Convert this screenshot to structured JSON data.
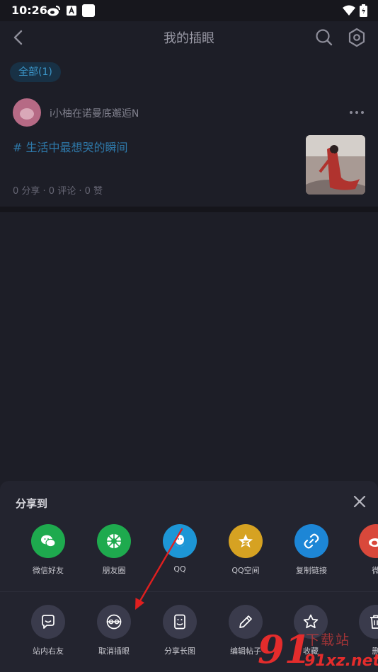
{
  "status_bar": {
    "time": "10:26"
  },
  "header": {
    "title": "我的插眼"
  },
  "filter": {
    "label": "全部(1)"
  },
  "post": {
    "author": "i小柚在诺曼底邂逅N",
    "tag": "# 生活中最想哭的瞬间",
    "stats": "0 分享 · 0 评论 · 0 赞"
  },
  "share_sheet": {
    "title": "分享到",
    "share_targets": [
      {
        "label": "微信好友",
        "color": "#1eaa4e",
        "icon": "wechat-icon"
      },
      {
        "label": "朋友圈",
        "color": "#1eaa4e",
        "icon": "moments-icon"
      },
      {
        "label": "QQ",
        "color": "#1d96d6",
        "icon": "qq-icon"
      },
      {
        "label": "QQ空间",
        "color": "#d6a222",
        "icon": "qzone-icon"
      },
      {
        "label": "复制链接",
        "color": "#1d86d6",
        "icon": "link-icon"
      },
      {
        "label": "微",
        "color": "#d9483b",
        "icon": "weibo-icon"
      }
    ],
    "actions": [
      {
        "label": "站内右友",
        "icon": "chat-face-icon"
      },
      {
        "label": "取消插眼",
        "icon": "eye-off-icon"
      },
      {
        "label": "分享长图",
        "icon": "long-image-icon"
      },
      {
        "label": "编辑帖子",
        "icon": "pencil-icon"
      },
      {
        "label": "收藏",
        "icon": "star-icon"
      },
      {
        "label": "删",
        "icon": "trash-icon"
      }
    ]
  },
  "watermark": {
    "number": "91",
    "text": "下载站",
    "url": "91xz.net"
  }
}
